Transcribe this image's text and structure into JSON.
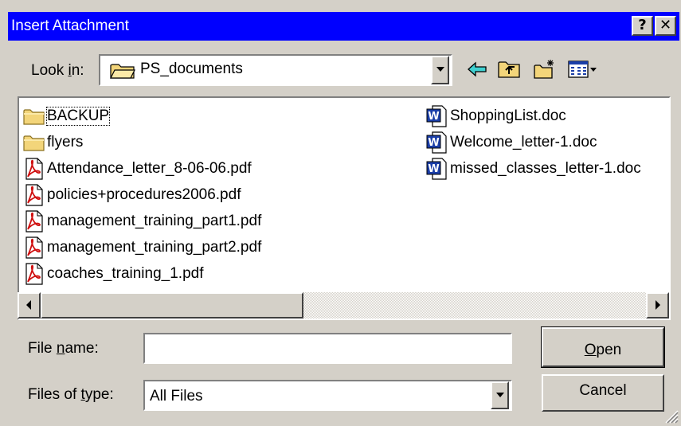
{
  "window": {
    "title": "Insert Attachment",
    "help_label": "?",
    "close_label": "✕"
  },
  "lookin": {
    "label_pre": "Look ",
    "label_key": "i",
    "label_post": "n:",
    "value": "PS_documents"
  },
  "toolbar": {
    "back_icon": "back-arrow-icon",
    "up_icon": "up-folder-icon",
    "new_folder_icon": "new-folder-icon",
    "view_menu_icon": "view-menu-icon"
  },
  "files": [
    {
      "name": "BACKUP",
      "type": "folder",
      "selected": true
    },
    {
      "name": "flyers",
      "type": "folder"
    },
    {
      "name": "Attendance_letter_8-06-06.pdf",
      "type": "pdf"
    },
    {
      "name": "policies+procedures2006.pdf",
      "type": "pdf"
    },
    {
      "name": "management_training_part1.pdf",
      "type": "pdf"
    },
    {
      "name": "management_training_part2.pdf",
      "type": "pdf"
    },
    {
      "name": "coaches_training_1.pdf",
      "type": "pdf"
    },
    {
      "name": "ShoppingList.doc",
      "type": "doc"
    },
    {
      "name": "Welcome_letter-1.doc",
      "type": "doc"
    },
    {
      "name": "missed_classes_letter-1.doc",
      "type": "doc"
    }
  ],
  "filename": {
    "label_pre": "File ",
    "label_key": "n",
    "label_post": "ame:",
    "value": ""
  },
  "filetype": {
    "label_pre": "Files of ",
    "label_key": "t",
    "label_post": "ype:",
    "value": "All Files"
  },
  "buttons": {
    "open_key": "O",
    "open_rest": "pen",
    "cancel": "Cancel"
  },
  "colors": {
    "titlebar": "#0000ff",
    "face": "#d4d0c8",
    "folder": "#f3d57a",
    "pdf": "#d01010",
    "doc": "#1a3ea8"
  }
}
